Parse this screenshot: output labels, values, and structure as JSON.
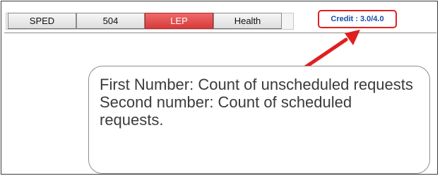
{
  "tabs": [
    {
      "label": "SPED",
      "active": false
    },
    {
      "label": "504",
      "active": false
    },
    {
      "label": "LEP",
      "active": true
    },
    {
      "label": "Health",
      "active": false
    }
  ],
  "credit": {
    "label": "Credit : 3.0/4.0"
  },
  "callout": {
    "line1": "First Number:  Count of unscheduled requests",
    "line2": "Second number:  Count of scheduled requests."
  },
  "colors": {
    "active_tab": "#d93a3a",
    "highlight": "#e01f1f",
    "credit_text": "#1a4aa8"
  },
  "icons": [
    "arrow-annotation-icon"
  ]
}
